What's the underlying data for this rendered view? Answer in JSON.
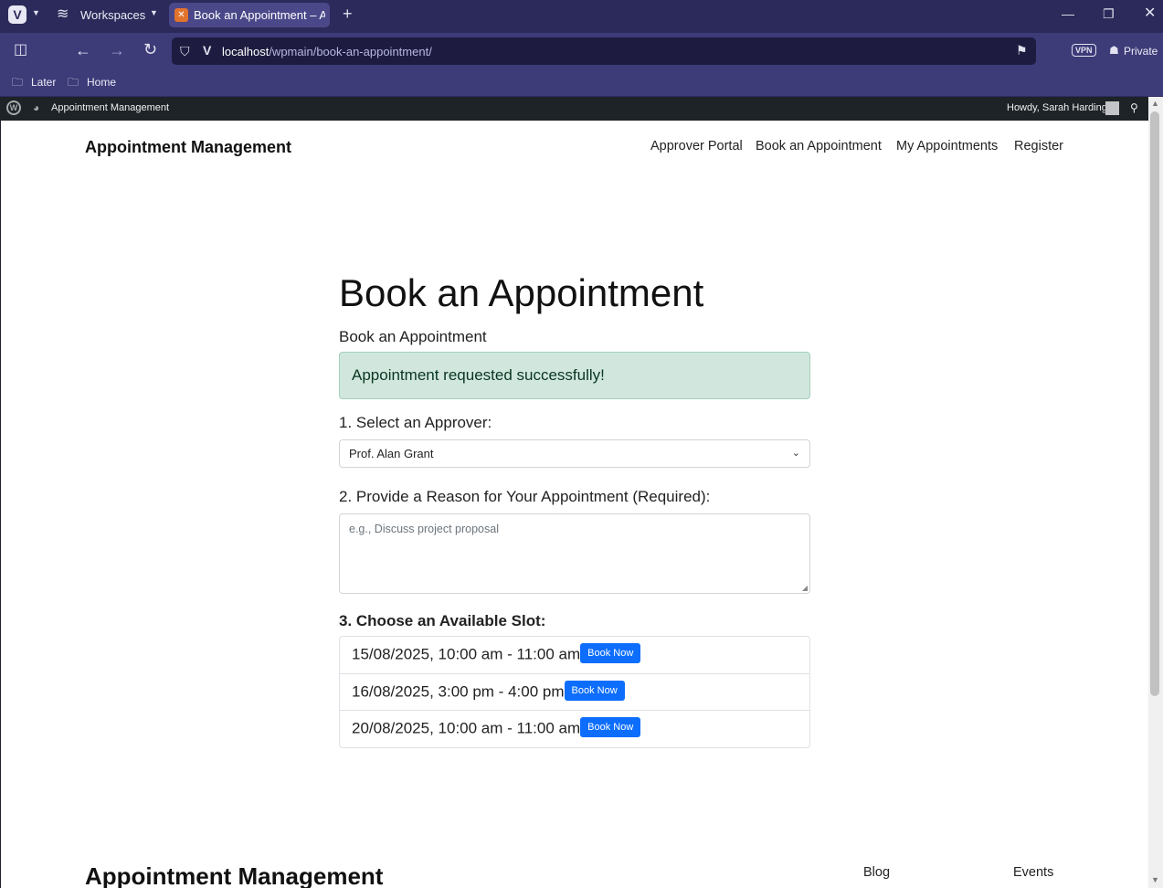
{
  "browser": {
    "workspaces_label": "Workspaces",
    "tab_title": "Book an Appointment – Ap",
    "url_host": "localhost",
    "url_path": "/wpmain/book-an-appointment/",
    "vpn_label": "VPN",
    "private_label": "Private",
    "bookmarks": [
      "Later",
      "Home"
    ]
  },
  "wp_admin_bar": {
    "site_name": "Appointment Management",
    "greeting": "Howdy, Sarah Harding"
  },
  "site": {
    "title": "Appointment Management",
    "nav": [
      "Approver Portal",
      "Book an Appointment",
      "My Appointments",
      "Register"
    ]
  },
  "main": {
    "heading": "Book an Appointment",
    "subheading": "Book an Appointment",
    "alert": "Appointment requested successfully!",
    "step1_label": "1. Select an Approver:",
    "approver_selected": "Prof. Alan Grant",
    "step2_label": "2. Provide a Reason for Your Appointment (Required):",
    "reason_placeholder": "e.g., Discuss project proposal",
    "step3_label": "3. Choose an Available Slot:",
    "slots": [
      {
        "time": "15/08/2025, 10:00 am - 11:00 am",
        "button": "Book Now"
      },
      {
        "time": "16/08/2025, 3:00 pm - 4:00 pm",
        "button": "Book Now"
      },
      {
        "time": "20/08/2025, 10:00 am - 11:00 am",
        "button": "Book Now"
      }
    ]
  },
  "footer": {
    "title": "Appointment Management",
    "links": [
      "Blog",
      "Events"
    ]
  },
  "colors": {
    "accent": "#0d6efd",
    "alert_bg": "#d1e7dd",
    "browser_chrome": "#3d3b78",
    "admin_bar": "#1d2327"
  }
}
